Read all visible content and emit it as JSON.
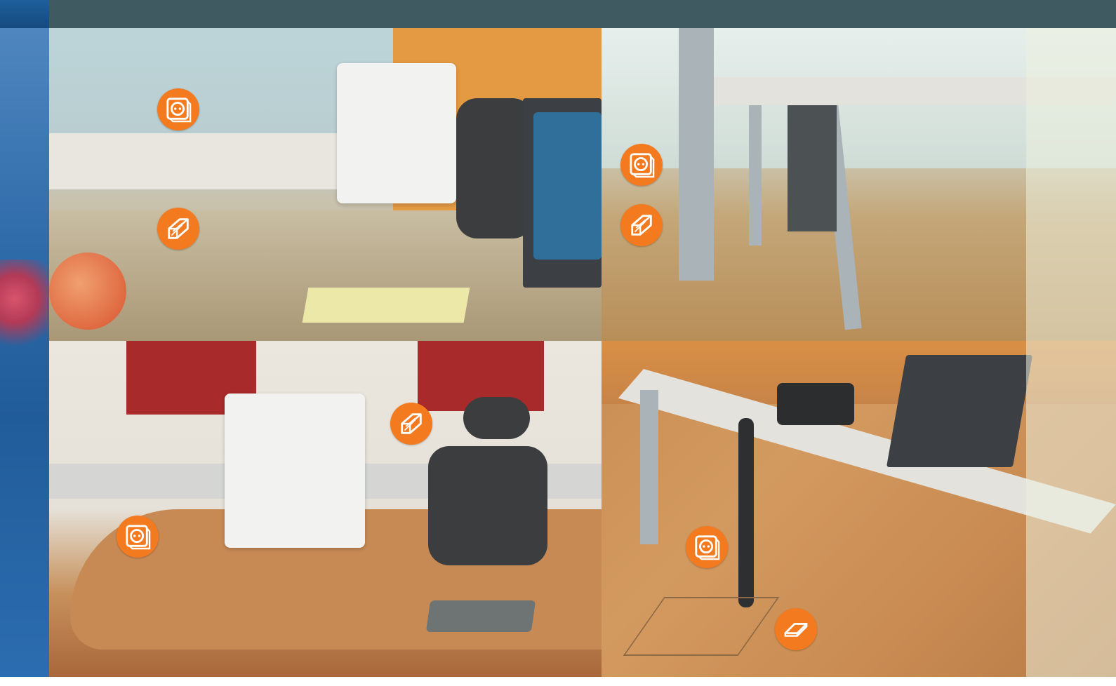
{
  "colors": {
    "header_bar": "#3f5a61",
    "left_strip": "#2d6aa8",
    "badge": "#f37a1f",
    "badge_glyph": "#ffffff"
  },
  "photos": [
    {
      "name": "office-desk-window"
    },
    {
      "name": "office-table-floor"
    },
    {
      "name": "office-desk-art"
    },
    {
      "name": "office-desk-floorbox"
    }
  ],
  "badges": [
    {
      "icon": "power-socket-icon"
    },
    {
      "icon": "cable-duct-icon"
    },
    {
      "icon": "power-socket-icon"
    },
    {
      "icon": "cable-duct-icon"
    },
    {
      "icon": "cable-duct-icon"
    },
    {
      "icon": "power-socket-icon"
    },
    {
      "icon": "power-socket-icon"
    },
    {
      "icon": "floor-duct-icon"
    }
  ]
}
